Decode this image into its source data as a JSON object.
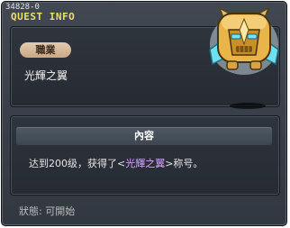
{
  "window": {
    "quest_id": "34828-0",
    "title": "QUEST INFO"
  },
  "quest": {
    "category": "職業",
    "name": "光輝之翼",
    "npc_icon": "golden-robot-icon"
  },
  "content": {
    "header": "內容",
    "text_before": "达到200级，获得了<",
    "title_name": "光輝之翼",
    "text_after": ">称号。"
  },
  "status": {
    "label": "狀態:",
    "value": "可開始"
  },
  "colors": {
    "window_bg": "#3a4149",
    "title": "#eae06a",
    "badge": "#d8bd9c",
    "highlight": "#d7a6ff"
  }
}
